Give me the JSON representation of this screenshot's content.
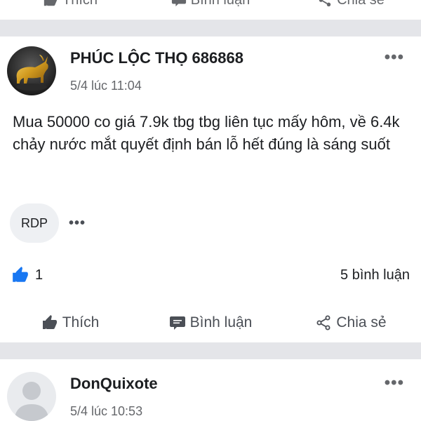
{
  "top_actions": {
    "like": "Thích",
    "comment": "Bình luận",
    "share": "Chia sẻ"
  },
  "post1": {
    "author": "PHÚC LỘC THỌ 686868",
    "time": "5/4 lúc 11:04",
    "content": "Mua 50000 co giá 7.9k tbg tbg liên tục mấy hôm, về 6.4k chảy nước mắt quyết định bán lỗ hết đúng là sáng suốt",
    "tag": "RDP",
    "like_count": "1",
    "comment_count": "5 bình luận",
    "actions": {
      "like": "Thích",
      "comment": "Bình luận",
      "share": "Chia sẻ"
    }
  },
  "post2": {
    "author": "DonQuixote",
    "time": "5/4 lúc 10:53"
  },
  "colors": {
    "accent": "#1877f2",
    "separator": "#e4e5e9",
    "muted": "#65676b"
  }
}
